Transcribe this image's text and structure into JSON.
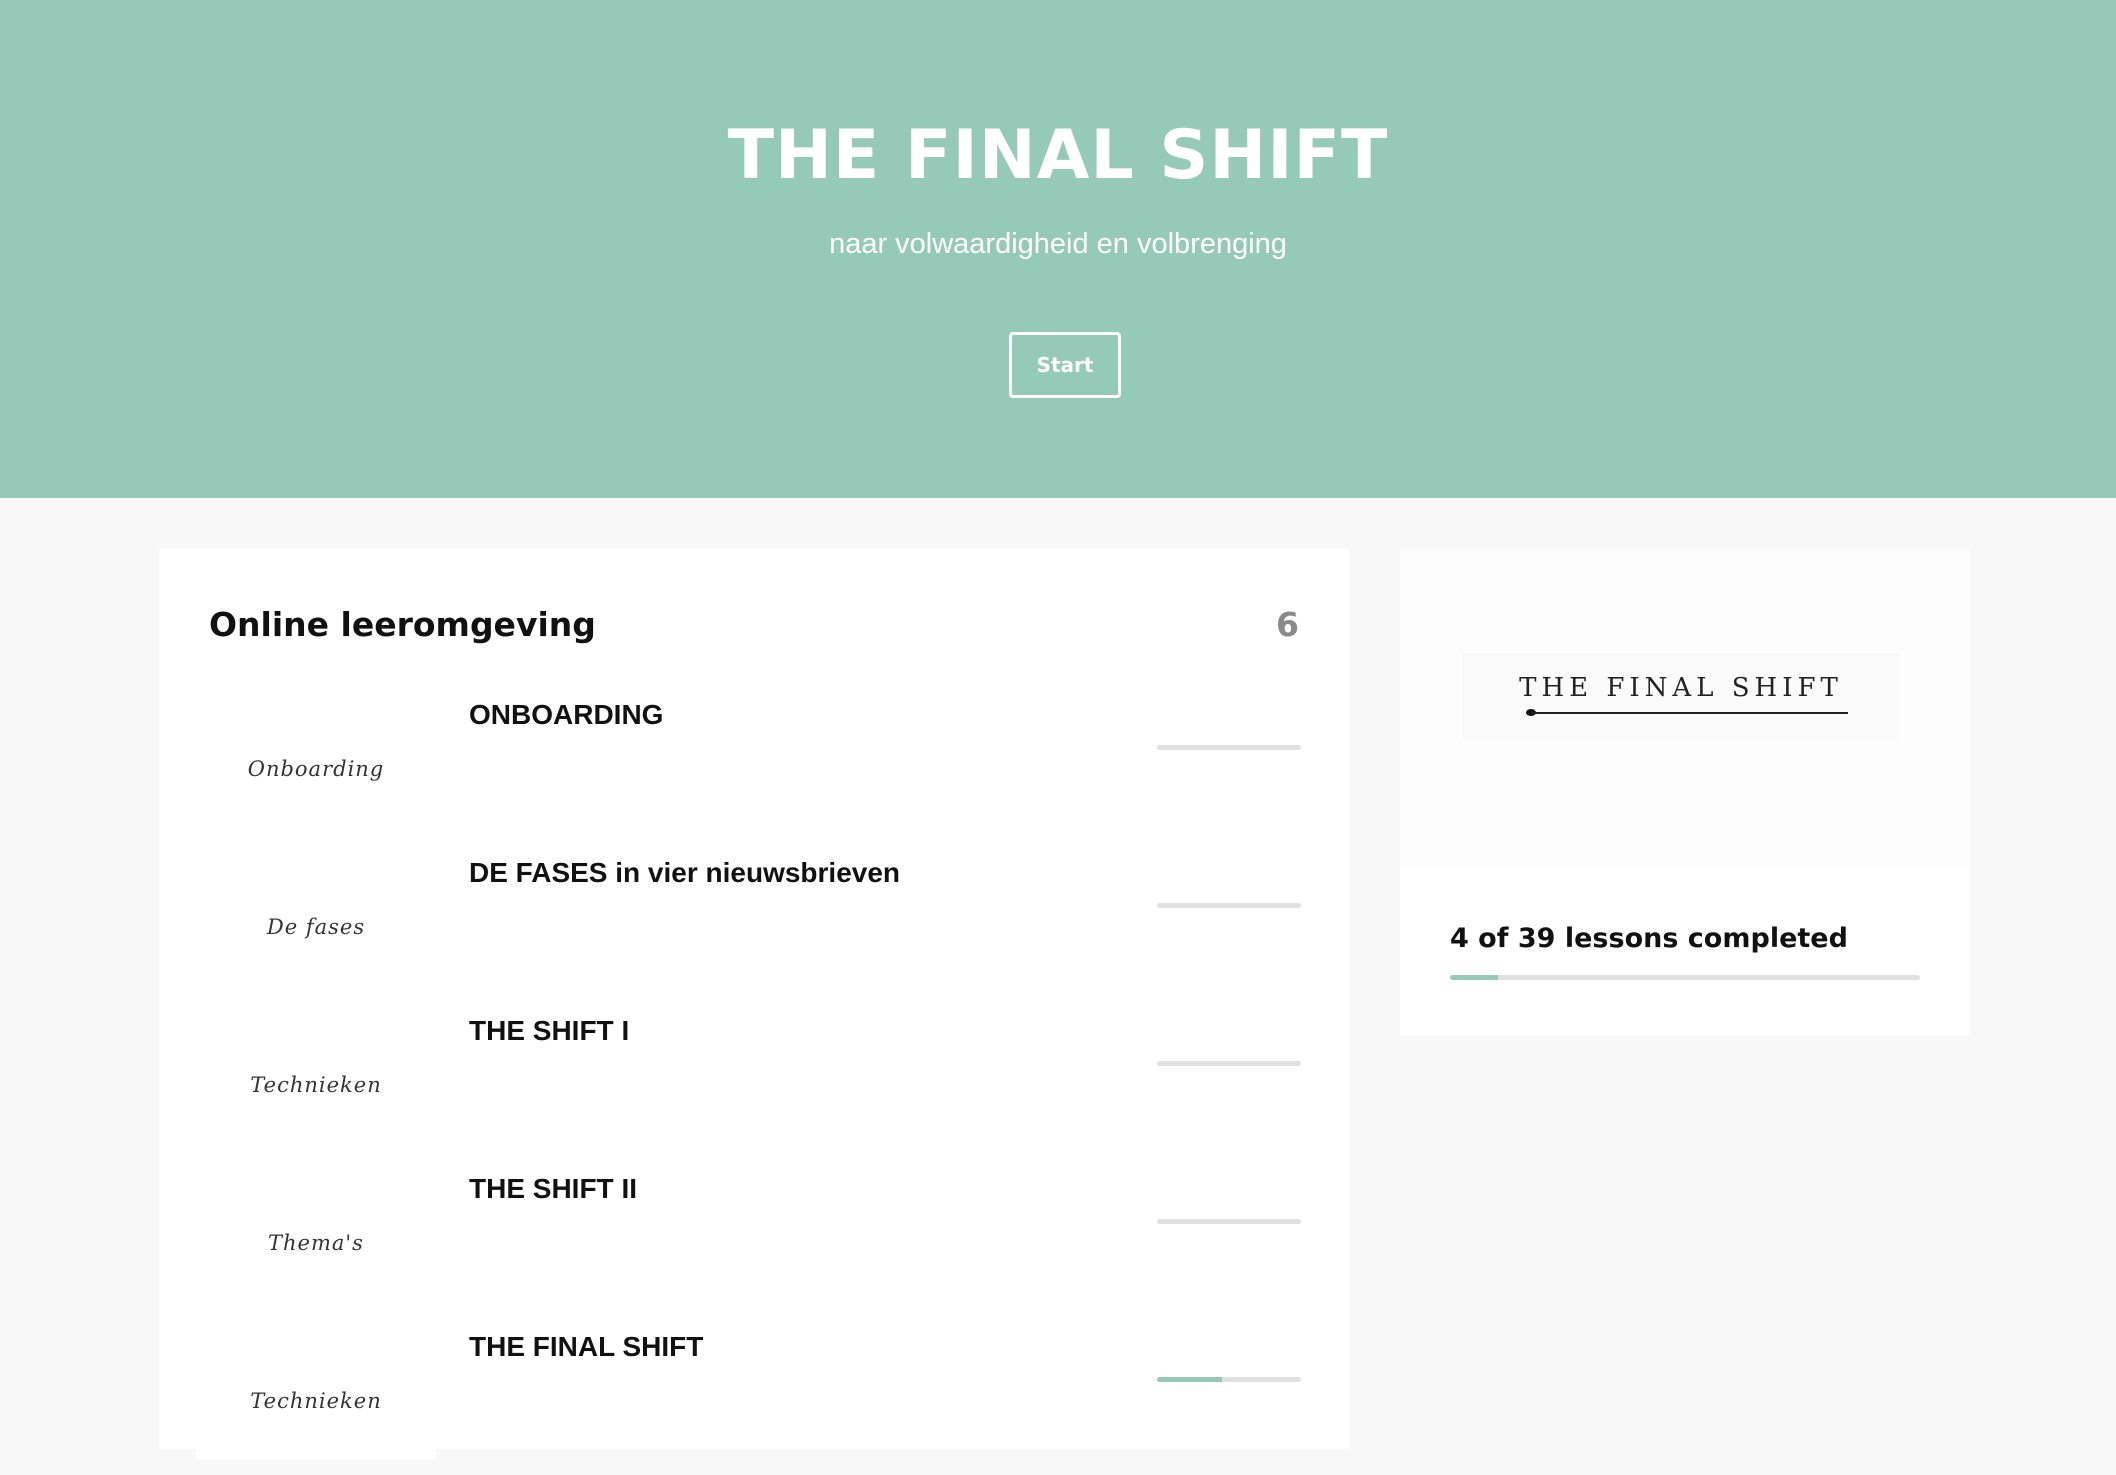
{
  "hero": {
    "title": "THE FINAL SHIFT",
    "subtitle": "naar volwaardigheid en volbrenging",
    "start_label": "Start",
    "background_color": "#96cab8"
  },
  "course": {
    "heading": "Online leeromgeving",
    "count": "6",
    "modules": [
      {
        "title": "ONBOARDING",
        "thumb_label": "Onboarding",
        "progress": 0
      },
      {
        "title": "DE FASES in vier nieuwsbrieven",
        "thumb_label": "De fases",
        "progress": 0
      },
      {
        "title": "THE SHIFT I",
        "thumb_label": "Technieken",
        "progress": 0
      },
      {
        "title": "THE SHIFT II",
        "thumb_label": "Thema's",
        "progress": 0
      },
      {
        "title": "THE FINAL SHIFT",
        "thumb_label": "Technieken",
        "progress": 0.45
      }
    ]
  },
  "sidebar": {
    "logo_text": "THE FINAL SHIFT",
    "progress_text": "4 of 39 lessons completed",
    "lessons_completed": 4,
    "lessons_total": 39
  },
  "colors": {
    "accent": "#96cab8",
    "track": "#e0e0e0",
    "page_background": "#f8f8f8"
  }
}
